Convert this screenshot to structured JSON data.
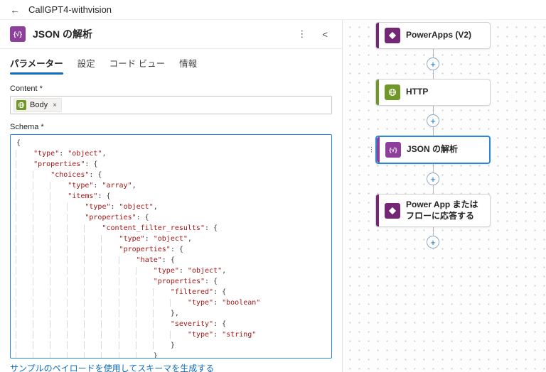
{
  "topbar": {
    "back_icon": "←",
    "title": "CallGPT4-withvision"
  },
  "panel": {
    "header": {
      "icon_glyph": "{√}",
      "icon_color": "#8c3f9b",
      "title": "JSON の解析",
      "more_icon": "⋮",
      "collapse_icon": "<"
    },
    "tabs": [
      {
        "label": "パラメーター",
        "active": true
      },
      {
        "label": "設定",
        "active": false
      },
      {
        "label": "コード ビュー",
        "active": false
      },
      {
        "label": "情報",
        "active": false
      }
    ],
    "content_field": {
      "label": "Content *",
      "token": {
        "label": "Body",
        "remove_icon": "×",
        "icon_color": "#709727"
      }
    },
    "schema_field": {
      "label": "Schema *",
      "code_lines": [
        "{",
        "    \"type\": \"object\",",
        "    \"properties\": {",
        "        \"choices\": {",
        "            \"type\": \"array\",",
        "            \"items\": {",
        "                \"type\": \"object\",",
        "                \"properties\": {",
        "                    \"content_filter_results\": {",
        "                        \"type\": \"object\",",
        "                        \"properties\": {",
        "                            \"hate\": {",
        "                                \"type\": \"object\",",
        "                                \"properties\": {",
        "                                    \"filtered\": {",
        "                                        \"type\": \"boolean\"",
        "                                    },",
        "                                    \"severity\": {",
        "                                        \"type\": \"string\"",
        "                                    }",
        "                                }"
      ]
    },
    "footer_link": "サンプルのペイロードを使用してスキーマを生成する"
  },
  "canvas": {
    "add_icon": "+",
    "drag_handle_icon": "⋮⋮",
    "selected_border": "#2b88d8",
    "nodes": [
      {
        "title": "PowerApps (V2)",
        "color": "#742774",
        "icon": "powerapps-icon",
        "selected": false
      },
      {
        "title": "HTTP",
        "color": "#709727",
        "icon": "http-icon",
        "selected": false
      },
      {
        "title": "JSON の解析",
        "color": "#8c3f9b",
        "icon": "parse-json-icon",
        "icon_glyph": "{√}",
        "selected": true
      },
      {
        "title": "Power App またはフローに応答する",
        "color": "#742774",
        "icon": "powerapps-icon",
        "selected": false
      }
    ]
  }
}
